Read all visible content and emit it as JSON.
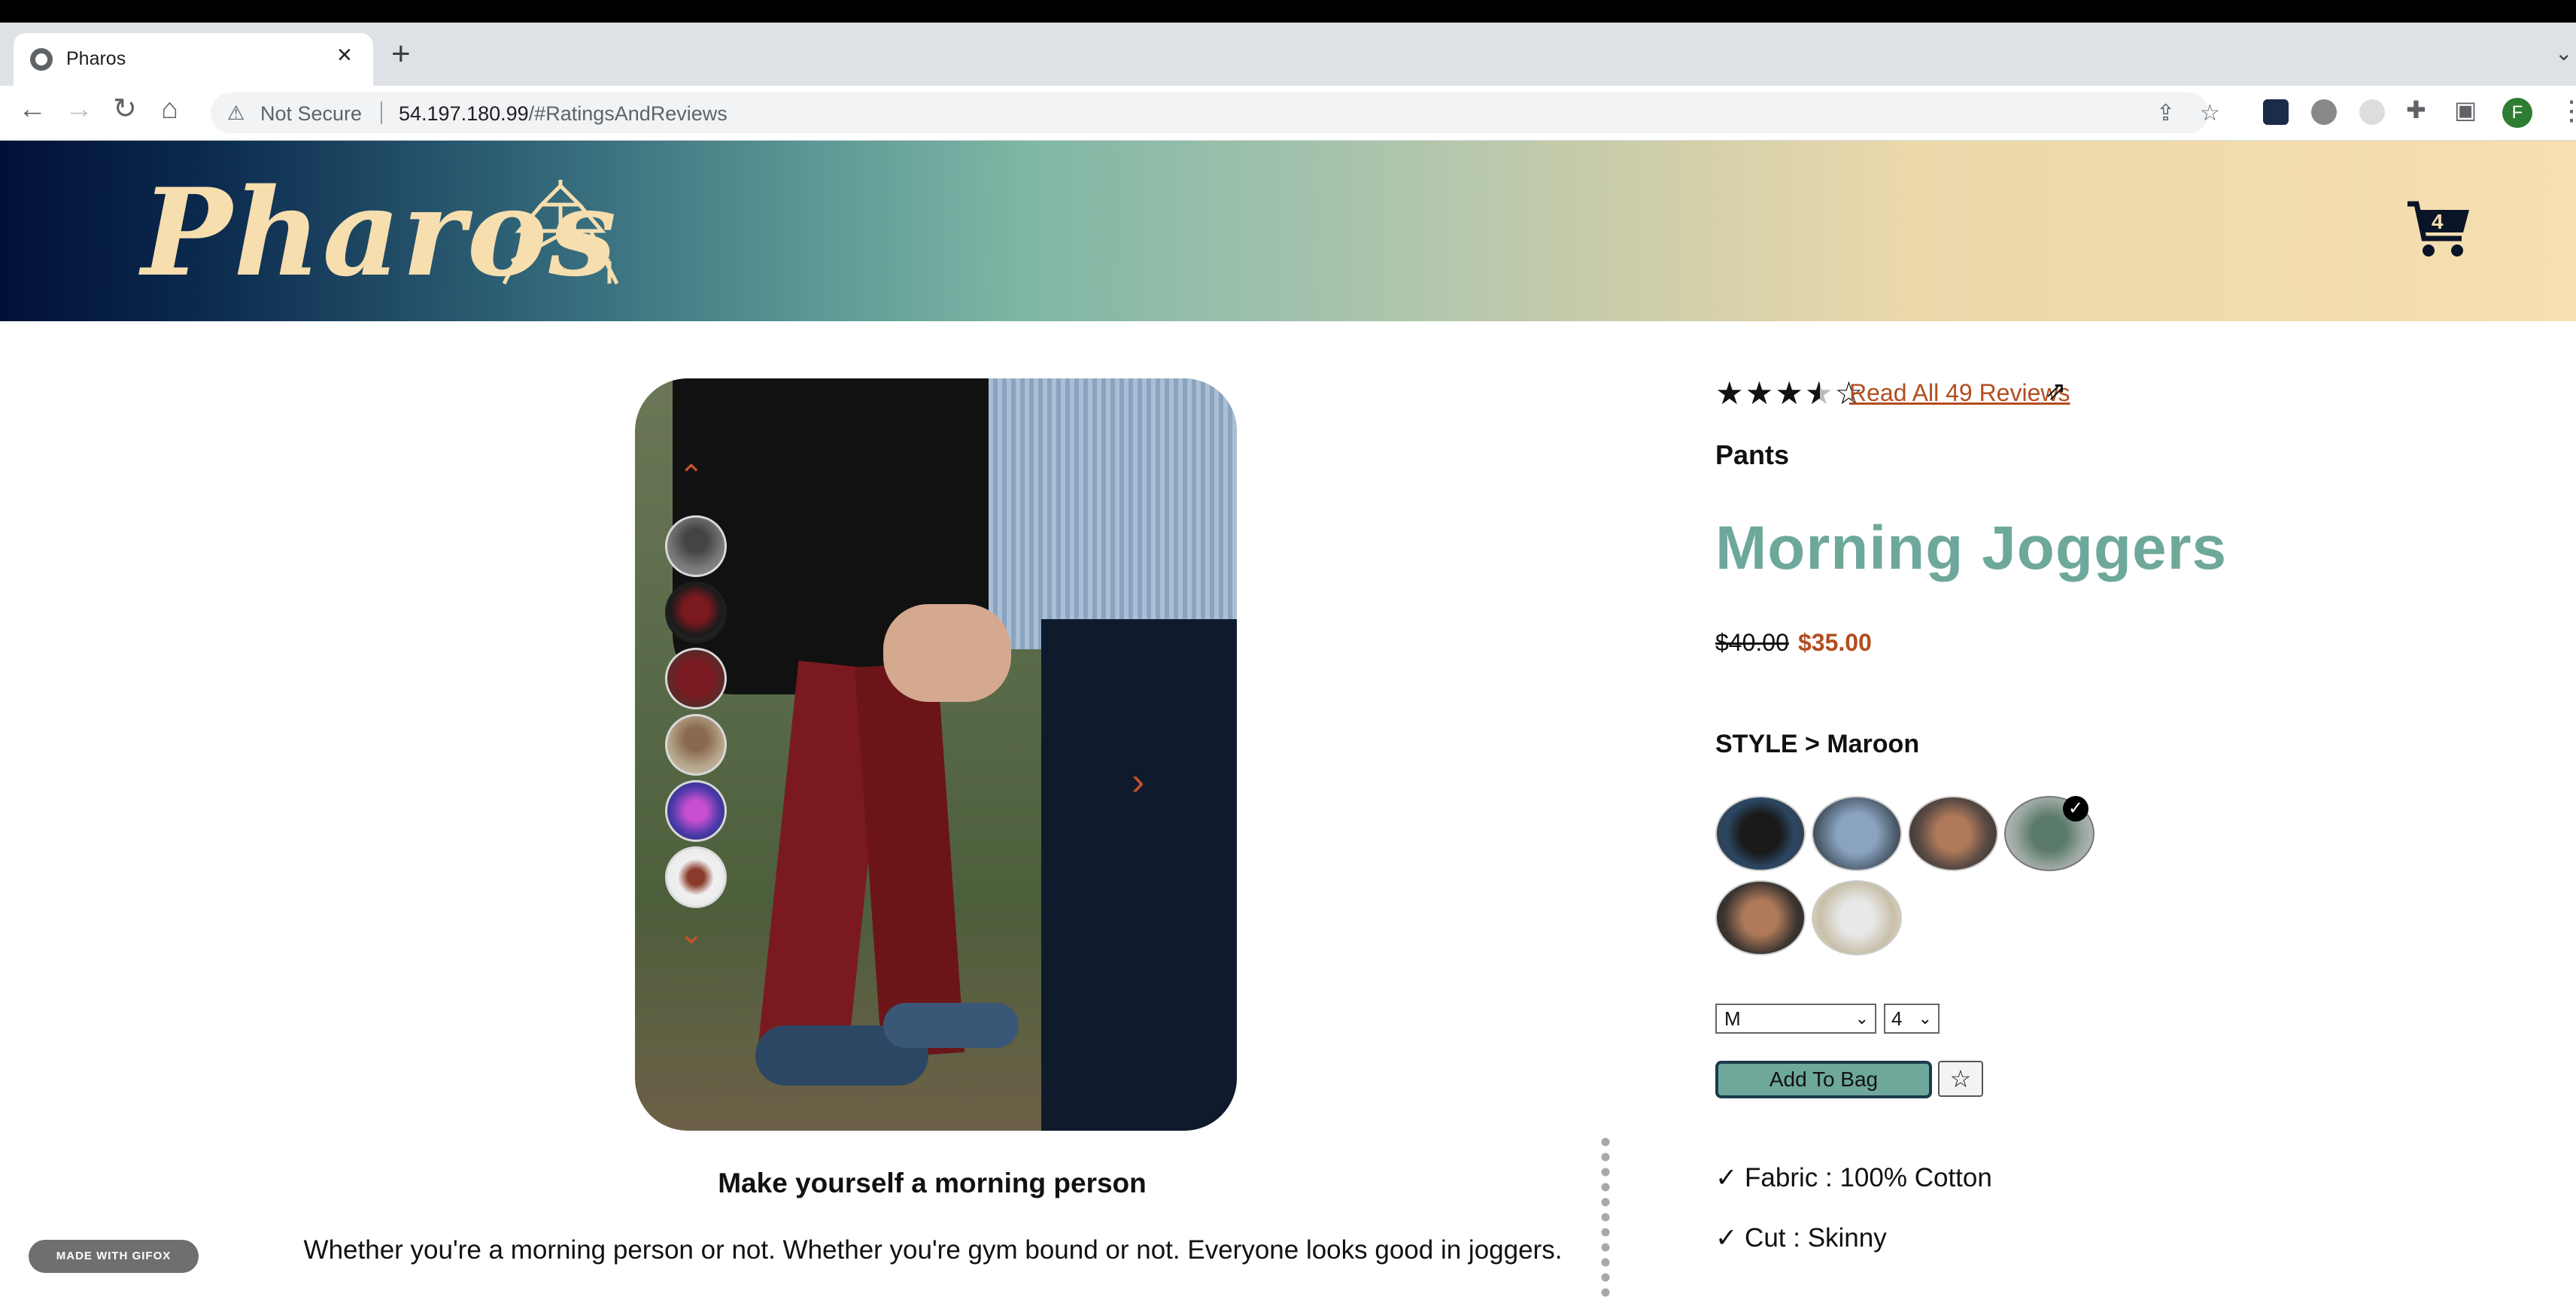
{
  "browser": {
    "tab_title": "Pharos",
    "tab_close": "×",
    "new_tab": "+",
    "security_label": "Not Secure",
    "url_host": "54.197.180.99",
    "url_path": "/#RatingsAndReviews",
    "avatar_letter": "F"
  },
  "header": {
    "logo_text": "Pharos",
    "cart_count": "4"
  },
  "carousel": {
    "up_arrow": "⌃",
    "down_arrow": "⌄",
    "next_arrow": "›",
    "active_thumbnail_index": 1,
    "thumbnail_count": 6
  },
  "overview": {
    "slogan": "Make yourself a morning person",
    "description": "Whether you're a morning person or not. Whether you're gym bound or not. Everyone looks good in joggers."
  },
  "product": {
    "rating_stars": 3.5,
    "reviews_link": "Read All 49 Reviews",
    "category": "Pants",
    "name": "Morning Joggers",
    "original_price": "$40.00",
    "sale_price": "$35.00",
    "style_label": "STYLE > Maroon",
    "selected_size": "M",
    "selected_quantity": "4",
    "add_to_bag_label": "Add To Bag",
    "favorite_icon": "☆",
    "features": [
      "✓ Fabric : 100% Cotton",
      "✓ Cut : Skinny"
    ]
  },
  "watermark": "MADE WITH GIFOX",
  "colors": {
    "accent_teal": "#6ea89b",
    "accent_rust": "#b34d1f",
    "logo_cream": "#f6deaf"
  }
}
